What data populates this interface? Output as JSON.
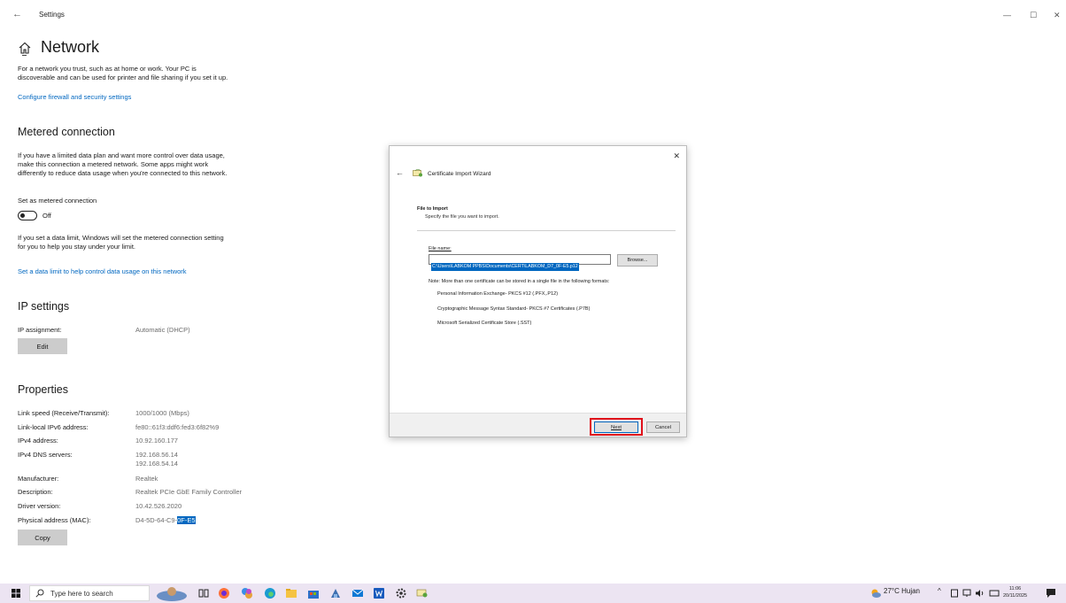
{
  "window": {
    "title": "Settings",
    "back_glyph": "←",
    "min_glyph": "—",
    "max_glyph": "☐",
    "close_glyph": "✕"
  },
  "page": {
    "title": "Network",
    "intro": [
      "For a network you trust, such as at home or work. Your PC is",
      "discoverable and can be used for printer and file sharing if you set it up."
    ],
    "firewall_link": "Configure firewall and security settings"
  },
  "metered": {
    "heading": "Metered connection",
    "desc": [
      "If you have a limited data plan and want more control over data usage,",
      "make this connection a metered network. Some apps might work",
      "differently to reduce data usage when you're connected to this network."
    ],
    "set_label": "Set as metered connection",
    "toggle_state": "Off",
    "limit_desc": [
      "If you set a data limit, Windows will set the metered connection setting",
      "for you to help you stay under your limit."
    ],
    "limit_link": "Set a data limit to help control data usage on this network"
  },
  "ip": {
    "heading": "IP settings",
    "assignment_label": "IP assignment:",
    "assignment_value": "Automatic (DHCP)",
    "edit_button": "Edit"
  },
  "properties": {
    "heading": "Properties",
    "rows": [
      {
        "k": "Link speed (Receive/Transmit):",
        "v": "1000/1000 (Mbps)"
      },
      {
        "k": "Link-local IPv6 address:",
        "v": "fe80::61f3:ddf6:fed3:6f82%9"
      },
      {
        "k": "IPv4 address:",
        "v": "10.92.160.177"
      },
      {
        "k": "IPv4 DNS servers:",
        "v": "192.168.56.14",
        "v2": "192.168.54.14"
      },
      {
        "k": "Manufacturer:",
        "v": "Realtek"
      },
      {
        "k": "Description:",
        "v": "Realtek PCIe GbE Family Controller"
      },
      {
        "k": "Driver version:",
        "v": "10.42.526.2020"
      },
      {
        "k": "Physical address (MAC):",
        "v": "D4-5D-64-C9-",
        "v_selected": "0F-E5"
      }
    ],
    "copy_button": "Copy"
  },
  "dialog": {
    "close_glyph": "✕",
    "back_glyph": "←",
    "title": "Certificate Import Wizard",
    "section_title": "File to Import",
    "section_subtitle": "Specify the file you want to import.",
    "file_label": "File name:",
    "file_value": "C:\\Users\\LABKOM PPBS\\Documents\\CERT\\LABKOM_D7_0F-E5.p12",
    "browse_button": "Browse...",
    "note": "Note:  More than one certificate can be stored in a single file in the following formats:",
    "formats": [
      "Personal Information Exchange- PKCS #12 (.PFX,.P12)",
      "Cryptographic Message Syntax Standard- PKCS #7 Certificates (.P7B)",
      "Microsoft Serialized Certificate Store (.SST)"
    ],
    "next_button": "Next",
    "cancel_button": "Cancel"
  },
  "taskbar": {
    "search_placeholder": "Type here to search",
    "weather": "27°C  Hujan",
    "time": "11:06",
    "date": "20/11/2025",
    "icons": [
      "task-view-icon",
      "firefox-icon",
      "copilot-icon",
      "edge-icon",
      "file-explorer-icon",
      "store-icon",
      "app-icon",
      "mail-icon",
      "word-icon",
      "settings-icon",
      "certificate-wizard-icon"
    ]
  }
}
